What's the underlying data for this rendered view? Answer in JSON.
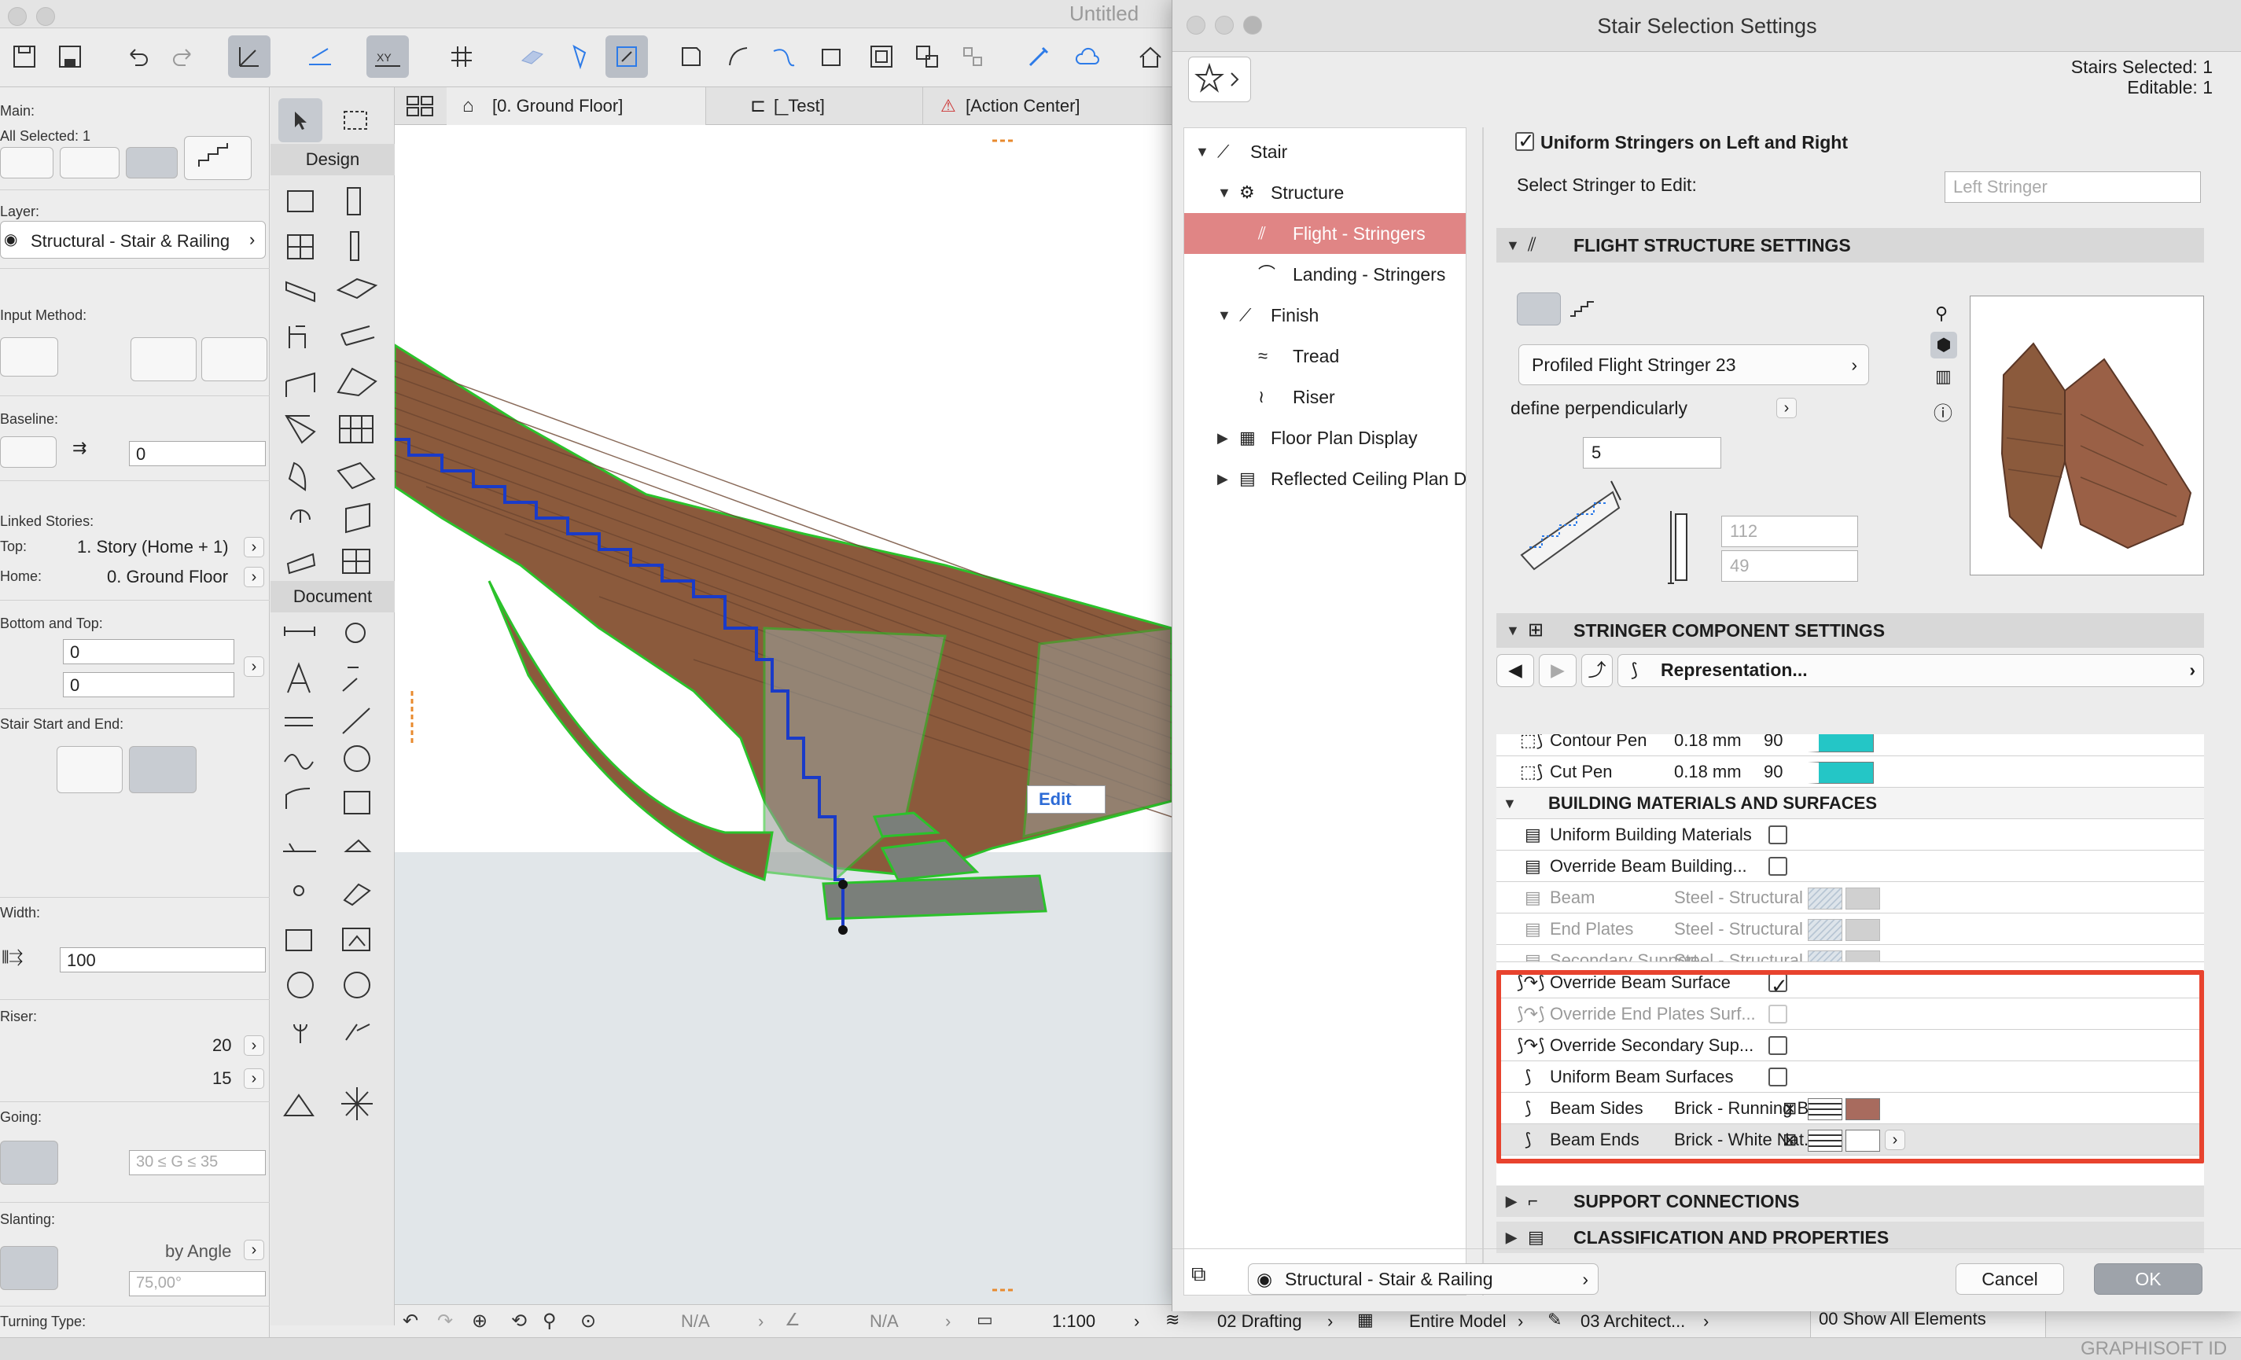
{
  "window": {
    "title": "Untitled"
  },
  "infobox": {
    "main_label": "Main:",
    "all_selected": "All Selected: 1",
    "layer_label": "Layer:",
    "layer_value": "Structural - Stair & Railing",
    "input_method_label": "Input Method:",
    "baseline_label": "Baseline:",
    "baseline_value": "0",
    "linked_stories_label": "Linked Stories:",
    "top_label": "Top:",
    "top_value": "1. Story (Home + 1)",
    "home_label": "Home:",
    "home_value": "0. Ground Floor",
    "bottom_top_label": "Bottom and Top:",
    "bottom_value": "0",
    "top_offset_value": "0",
    "stair_start_end_label": "Stair Start and End:",
    "width_label": "Width:",
    "width_value": "100",
    "riser_label": "Riser:",
    "riser_count": "20",
    "riser_height": "15",
    "going_label": "Going:",
    "going_rule": "30 ≤ G ≤ 35",
    "slanting_label": "Slanting:",
    "slanting_mode": "by Angle",
    "slanting_value": "75,00°",
    "turning_type_label": "Turning Type:"
  },
  "toolbox": {
    "design_label": "Design",
    "document_label": "Document"
  },
  "view_tabs": [
    "[0. Ground Floor]",
    "[_Test]",
    "[Action Center]"
  ],
  "viewport": {
    "edit_label": "Edit"
  },
  "statusbar": {
    "na1": "N/A",
    "na2": "N/A",
    "scale": "1:100",
    "drafting": "02 Drafting",
    "model": "Entire Model",
    "architect": "03 Architect...",
    "show_all": "00 Show All Elements"
  },
  "brand": "GRAPHISOFT ID",
  "dialog": {
    "title": "Stair Selection Settings",
    "stairs_selected": "Stairs Selected: 1",
    "editable": "Editable: 1",
    "tree": {
      "stair": "Stair",
      "structure": "Structure",
      "flight_stringers": "Flight - Stringers",
      "landing_stringers": "Landing - Stringers",
      "finish": "Finish",
      "tread": "Tread",
      "riser": "Riser",
      "floor_plan_display": "Floor Plan Display",
      "reflected_ceiling": "Reflected Ceiling Plan D"
    },
    "uniform_stringers_label": "Uniform Stringers on Left and Right",
    "uniform_stringers_checked": true,
    "select_stringer_label": "Select Stringer to Edit:",
    "select_stringer_value": "Left Stringer",
    "flight_structure_header": "FLIGHT STRUCTURE SETTINGS",
    "profile_name": "Profiled Flight Stringer 23",
    "define_perp": "define perpendicularly",
    "value_5": "5",
    "value_112": "112",
    "value_49": "49",
    "stringer_component_header": "STRINGER COMPONENT SETTINGS",
    "representation_label": "Representation...",
    "rows_pen": [
      {
        "label": "Contour Pen",
        "value": "0.18 mm",
        "num": "90",
        "color": "#24c6c6"
      },
      {
        "label": "Cut Pen",
        "value": "0.18 mm",
        "num": "90",
        "color": "#24c6c6"
      }
    ],
    "building_materials_header": "BUILDING MATERIALS AND SURFACES",
    "rows_bm": [
      {
        "label": "Uniform Building Materials",
        "checked": false
      },
      {
        "label": "Override Beam Building...",
        "checked": false
      }
    ],
    "rows_mat": [
      {
        "label": "Beam",
        "value": "Steel - Structural"
      },
      {
        "label": "End Plates",
        "value": "Steel - Structural"
      },
      {
        "label": "Secondary Support",
        "value": "Steel - Structural"
      }
    ],
    "rows_surface": [
      {
        "label": "Override Beam Surface",
        "checked": true,
        "dim": false
      },
      {
        "label": "Override End Plates Surf...",
        "checked": false,
        "dim": true
      },
      {
        "label": "Override Secondary Sup...",
        "checked": false,
        "dim": false
      },
      {
        "label": "Uniform Beam Surfaces",
        "checked": false,
        "dim": false
      }
    ],
    "beam_sides": {
      "label": "Beam Sides",
      "value": "Brick - Running B...",
      "color": "#a86b5e"
    },
    "beam_ends": {
      "label": "Beam Ends",
      "value": "Brick - White Nat...",
      "color": "#ffffff"
    },
    "support_connections_header": "SUPPORT CONNECTIONS",
    "classification_header": "CLASSIFICATION AND PROPERTIES",
    "footer_layer": "Structural - Stair & Railing",
    "cancel_label": "Cancel",
    "ok_label": "OK"
  },
  "colors": {
    "highlight": "#e8432e",
    "selection": "#e08585",
    "stair_outline": "#2bc22b",
    "brick": "#8b5a3c"
  }
}
